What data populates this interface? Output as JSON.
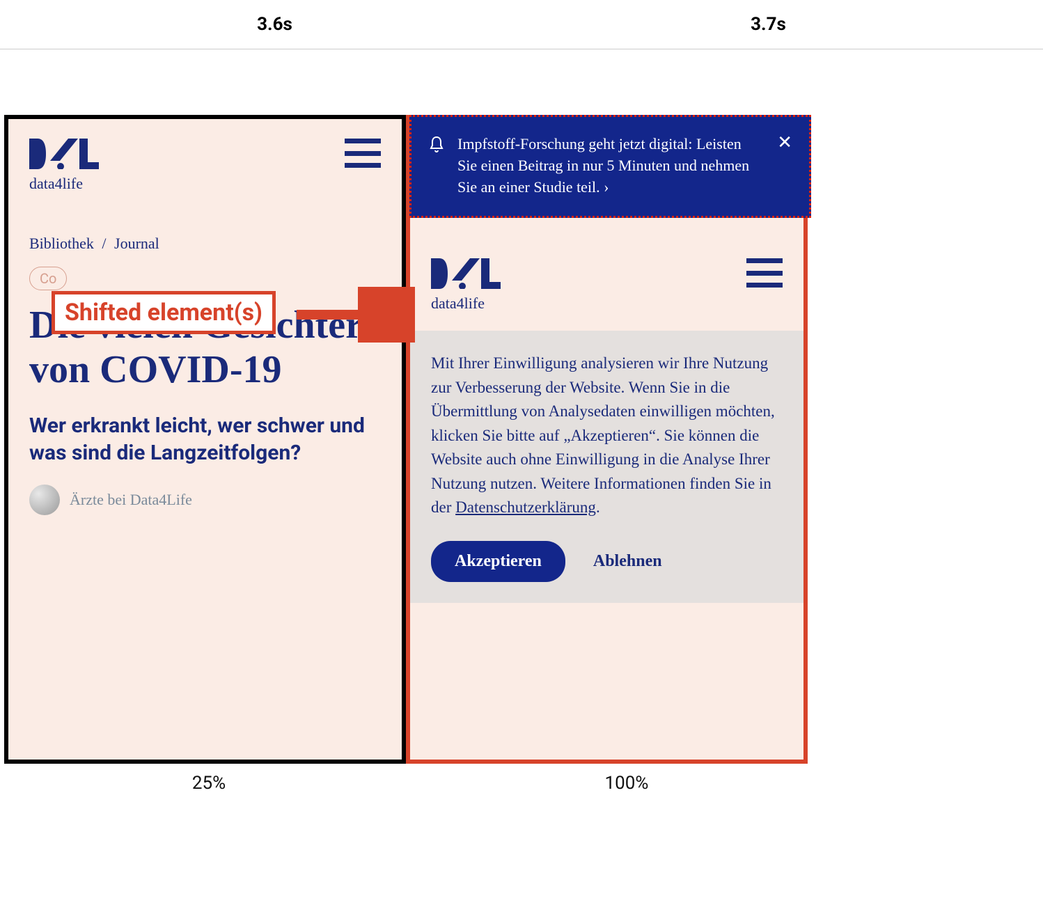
{
  "top": {
    "left_time": "3.6s",
    "right_time": "3.7s"
  },
  "bottom": {
    "left_pct": "25%",
    "right_pct": "100%"
  },
  "annotation": {
    "shift_label": "Shifted element(s)"
  },
  "left_shot": {
    "logo_text": "data4life",
    "breadcrumb": {
      "lib": "Bibliothek",
      "sep": "/",
      "journal": "Journal"
    },
    "tag_partial": "Co",
    "headline": "Die vielen Gesichter von COVID-19",
    "subheadline": "Wer erkrankt leicht, wer schwer und was sind die Langzeitfolgen?",
    "author": "Ärzte bei Data4Life"
  },
  "right_shot": {
    "banner_text": "Impfstoff-Forschung geht jetzt digital: Leisten Sie einen Beitrag in nur 5 Minuten und nehmen Sie an einer Studie teil. ›",
    "logo_text": "data4life",
    "consent_text": "Mit Ihrer Einwilligung analysieren wir Ihre Nutzung zur Verbesserung der Website. Wenn Sie in die Übermittlung von Analysedaten einwilligen möchten, klicken Sie bitte auf „Akzeptieren“. Sie können die Website auch ohne Einwilligung in die Analyse Ihrer Nutzung nutzen. Weitere Informationen finden Sie in der ",
    "consent_link": "Datenschutzerklärung",
    "consent_dot": ".",
    "accept": "Akzeptieren",
    "reject": "Ablehnen"
  }
}
